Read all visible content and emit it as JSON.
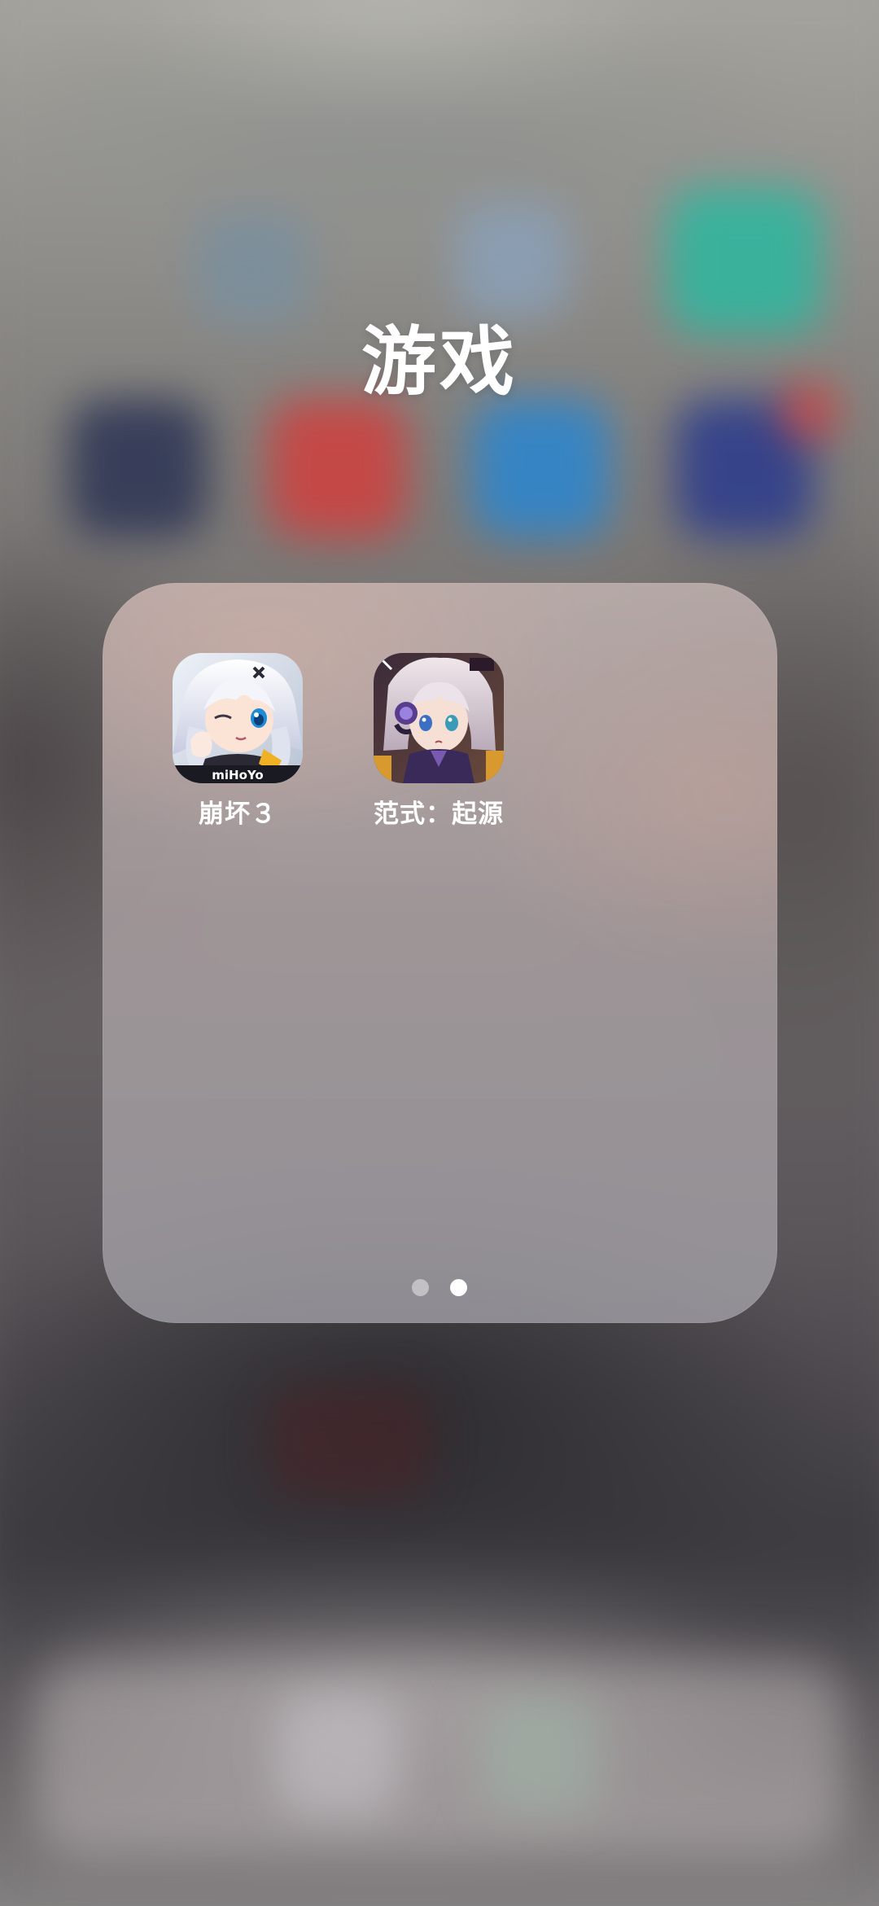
{
  "folder": {
    "title": "游戏",
    "apps": [
      {
        "label": "崩坏３",
        "icon": "honkai-impact-3-icon",
        "brand_text": "miHoYo"
      },
      {
        "label": "范式：起源",
        "icon": "paradigm-origin-icon"
      }
    ],
    "pages": {
      "count": 2,
      "current": 2
    }
  },
  "colors": {
    "text": "#ffffff",
    "folder_background": "#b3a9a8",
    "dot_inactive": "#cfcccc",
    "dot_active": "#ffffff"
  }
}
